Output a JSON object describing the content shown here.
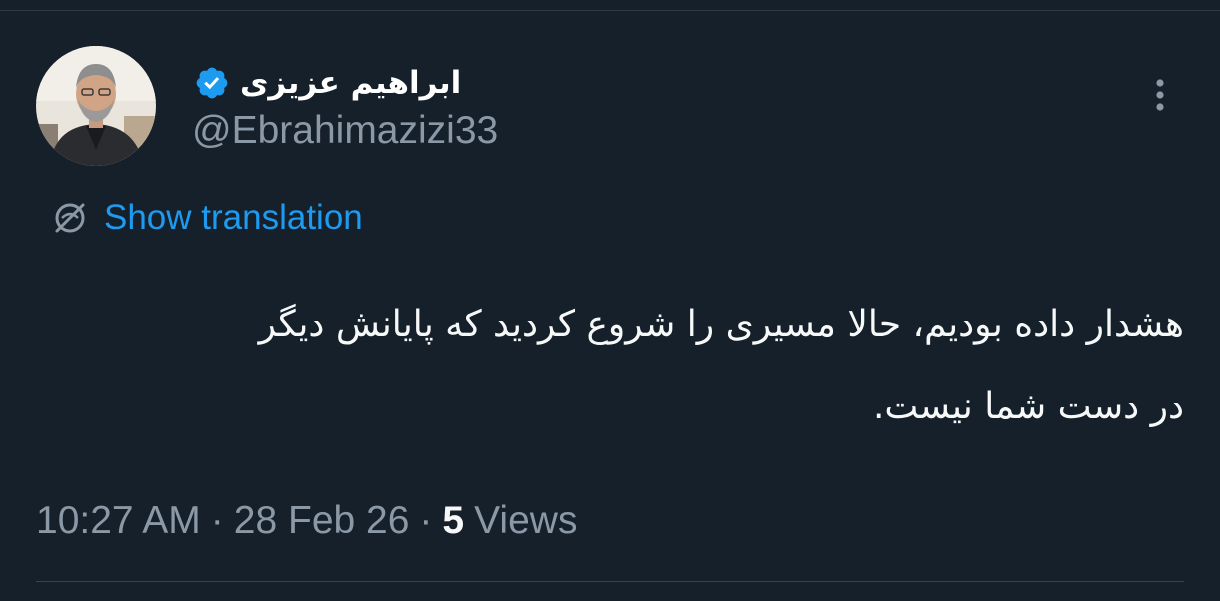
{
  "author": {
    "display_name": "ابراهیم عزیزی",
    "handle": "@Ebrahimazizi33",
    "verified": true
  },
  "translation_link": "Show translation",
  "tweet": {
    "lines": [
      "هشدار داده بودیم، حالا مسیری را شروع کردید که پایانش دیگر",
      "در دست شما نیست."
    ]
  },
  "meta": {
    "time": "10:27 AM",
    "separator": "·",
    "date": "28 Feb 26",
    "views_count": "5",
    "views_label": "Views"
  },
  "icons": {
    "verified": "verified-badge-icon",
    "translate": "globe-translate-icon",
    "more": "more-vertical-icon"
  },
  "colors": {
    "background": "#15202b",
    "accent": "#1d9bf0",
    "text_primary": "#f7f9f9",
    "text_secondary": "#8b98a5"
  }
}
